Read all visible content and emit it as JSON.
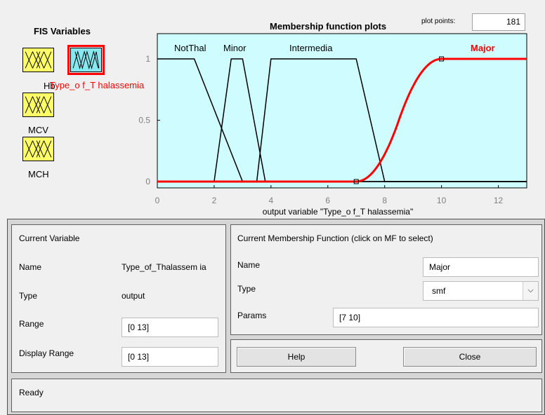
{
  "fis_variables": {
    "title": "FIS Variables",
    "inputs": [
      "Hb",
      "MCV",
      "MCH"
    ],
    "output": "Type_of_Thalassemia",
    "output_label_display": "Type_o f_T halassemia"
  },
  "plot": {
    "title": "Membership function plots",
    "plot_points_label": "plot points:",
    "plot_points_value": "181",
    "xlabel": "output variable \"Type_o f_T halassemia\"",
    "mf_labels": [
      "NotThal",
      "Minor",
      "Intermedia",
      "Major"
    ],
    "selected_mf_color": "#ff0000",
    "background_color": "#cffcff"
  },
  "chart_data": {
    "type": "line",
    "xlim": [
      0,
      13
    ],
    "ylim": [
      0,
      1
    ],
    "x_ticks": [
      "0",
      "2",
      "4",
      "6",
      "8",
      "10",
      "12"
    ],
    "y_ticks": [
      "0",
      "0.5",
      "1"
    ],
    "series": [
      {
        "name": "NotThal",
        "shape": "trapezoid",
        "points": [
          [
            0,
            1
          ],
          [
            1.3,
            1
          ],
          [
            3,
            0
          ],
          [
            13,
            0
          ]
        ]
      },
      {
        "name": "Minor",
        "shape": "trapmf",
        "points": [
          [
            0,
            0
          ],
          [
            2,
            0
          ],
          [
            2.6,
            1
          ],
          [
            3,
            1
          ],
          [
            3.8,
            0
          ],
          [
            13,
            0
          ]
        ]
      },
      {
        "name": "Intermedia",
        "shape": "trapmf",
        "points": [
          [
            0,
            0
          ],
          [
            3.5,
            0
          ],
          [
            4,
            1
          ],
          [
            7,
            1
          ],
          [
            8,
            0
          ],
          [
            13,
            0
          ]
        ]
      },
      {
        "name": "Major",
        "shape": "smf",
        "params": [
          7,
          10
        ],
        "selected": true
      }
    ]
  },
  "current_variable": {
    "header": "Current Variable",
    "name_label": "Name",
    "name_value": "Type_of_Thalassem\nia",
    "type_label": "Type",
    "type_value": "output",
    "range_label": "Range",
    "range_value": "[0 13]",
    "display_range_label": "Display Range",
    "display_range_value": "[0 13]"
  },
  "current_mf": {
    "header": "Current Membership Function (click on MF to select)",
    "name_label": "Name",
    "name_value": "Major",
    "type_label": "Type",
    "type_value": "smf",
    "params_label": "Params",
    "params_value": "[7 10]"
  },
  "buttons": {
    "help": "Help",
    "close": "Close"
  },
  "status": "Ready"
}
